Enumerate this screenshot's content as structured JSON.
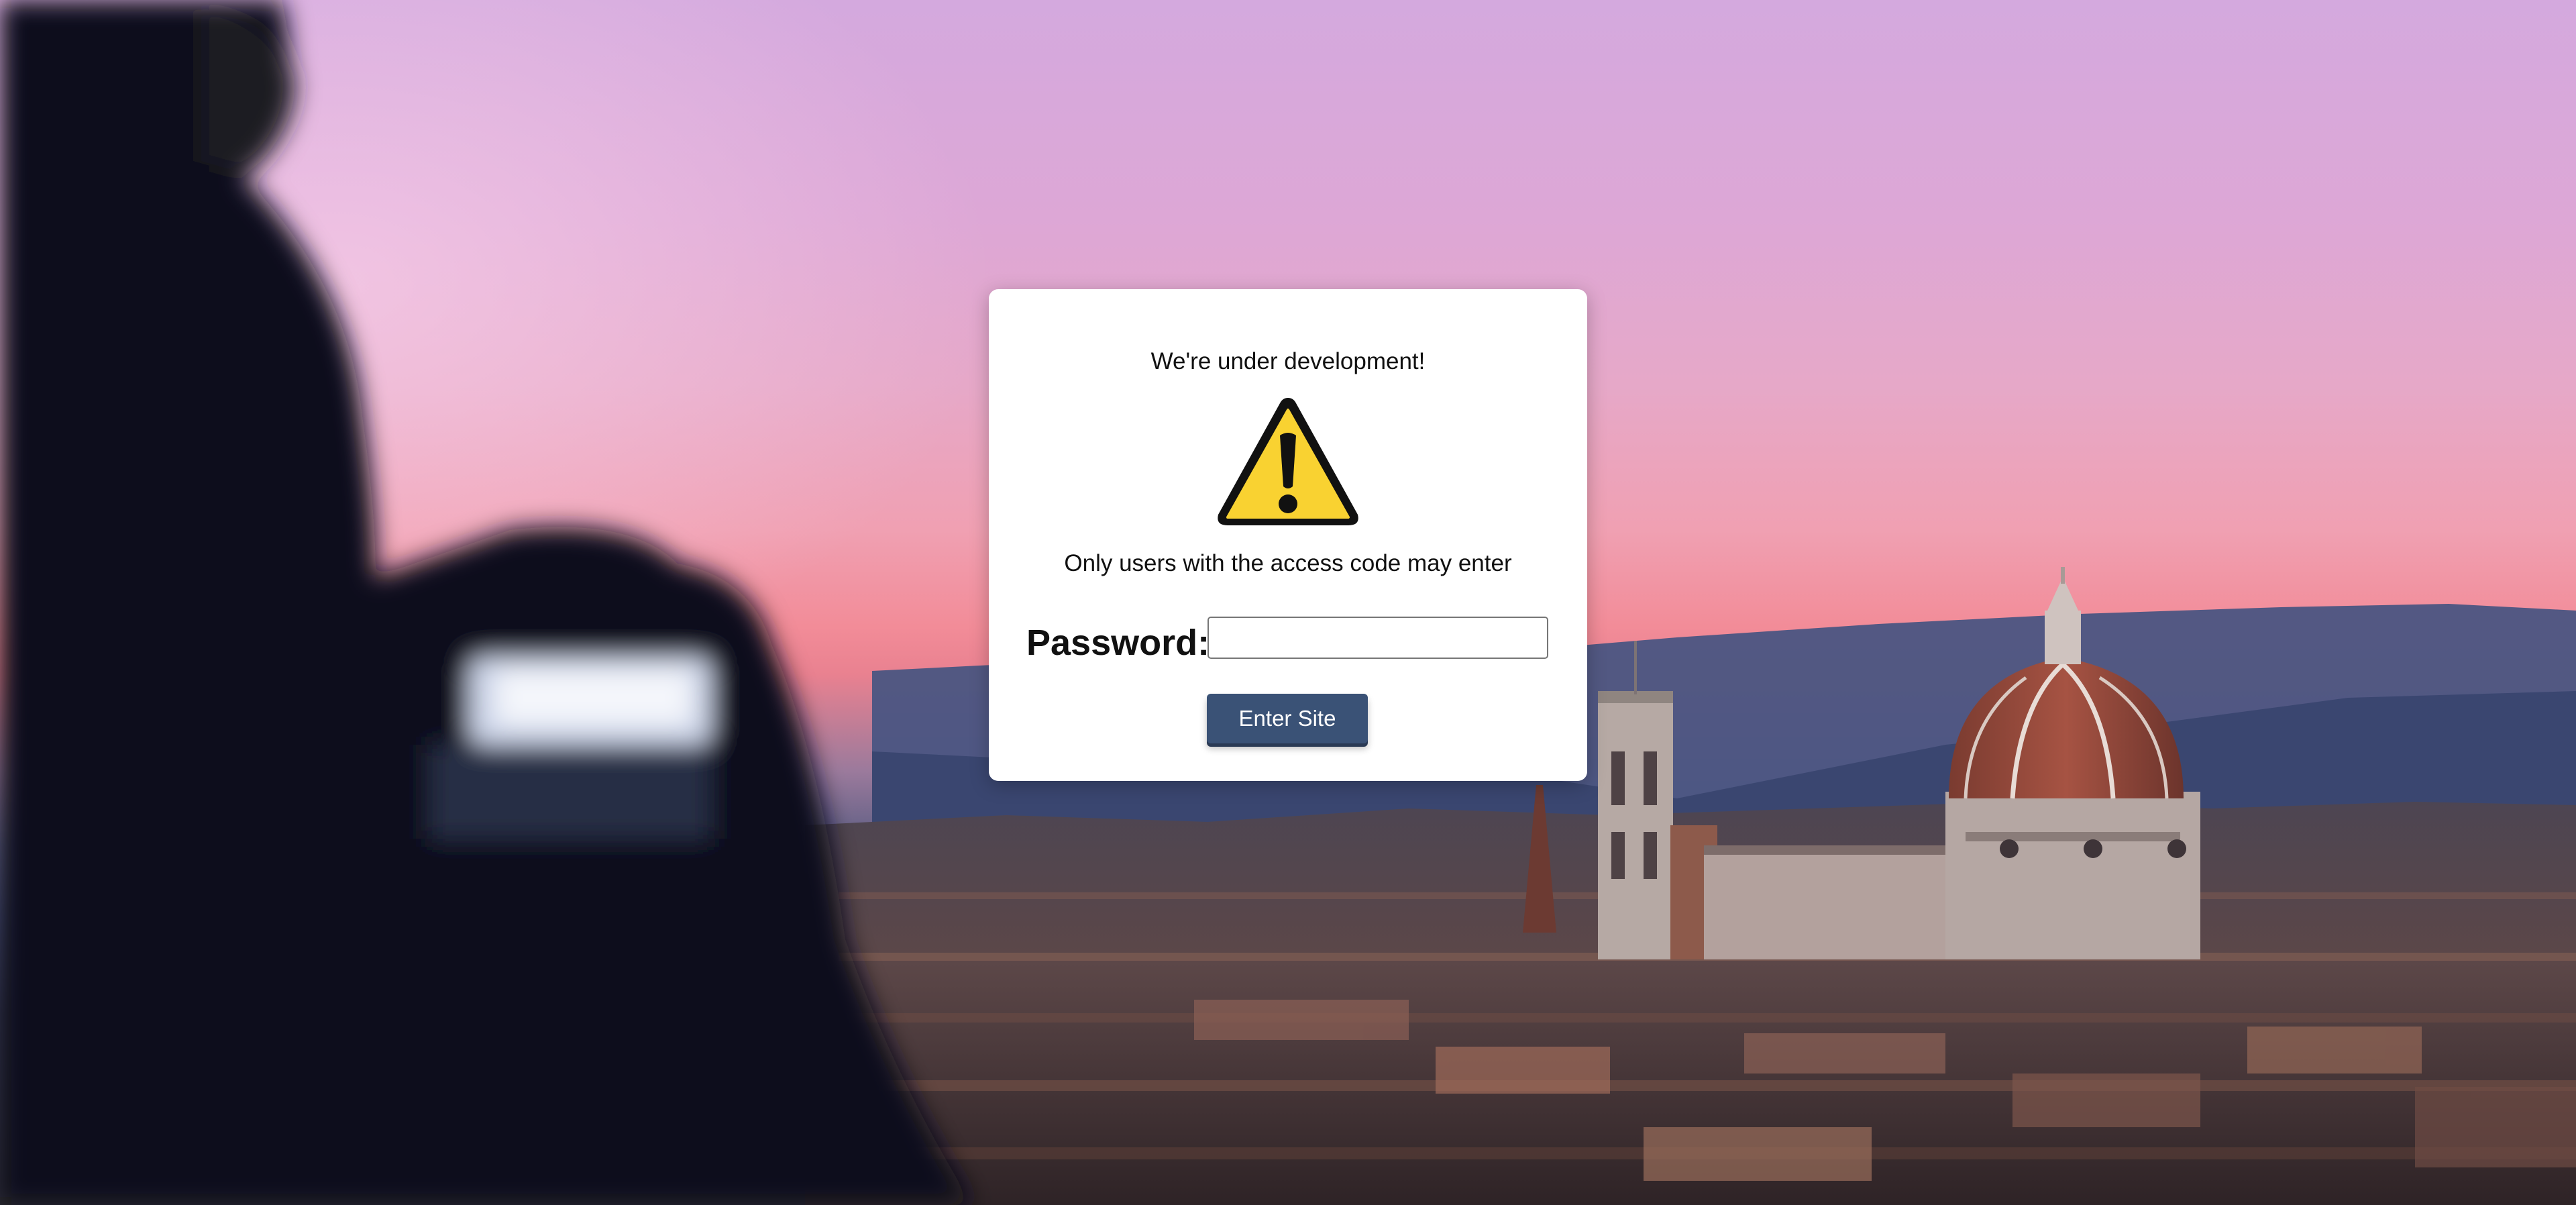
{
  "modal": {
    "heading": "We're under development!",
    "icon": "warning-icon",
    "subtext": "Only users with the access code may enter",
    "password_label": "Password:",
    "password_value": "",
    "password_placeholder": "",
    "submit_label": "Enter Site"
  },
  "colors": {
    "button_bg": "#3a5276",
    "warning_yellow": "#f9d231",
    "modal_bg": "#ffffff"
  }
}
